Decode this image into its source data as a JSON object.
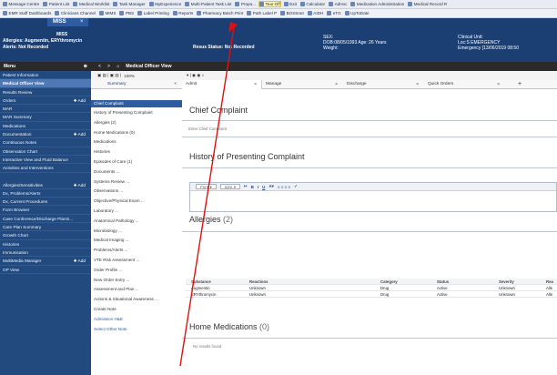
{
  "toolbar1": [
    {
      "label": "Message Centre"
    },
    {
      "label": "Patient List"
    },
    {
      "label": "Medical Worklist"
    },
    {
      "label": "Task Manager"
    },
    {
      "label": "MyExperience"
    },
    {
      "label": "Multi-Patient Task List"
    },
    {
      "label": "Propo..."
    },
    {
      "label": "Tear Off",
      "highlight": true
    },
    {
      "label": "Exit"
    },
    {
      "label": "Calculator"
    },
    {
      "label": "AdHoc"
    },
    {
      "label": "Medication Administration"
    },
    {
      "label": "Medical Record R"
    }
  ],
  "toolbar2": [
    {
      "label": "EMR Staff Dashboards"
    },
    {
      "label": "Clinicians Channel"
    },
    {
      "label": "MIMS"
    },
    {
      "label": "PBS"
    },
    {
      "label": "Label Printing"
    },
    {
      "label": "Reports"
    },
    {
      "label": "Pharmacy Batch Print"
    },
    {
      "label": "Path Label P"
    },
    {
      "label": "BOSSnet"
    },
    {
      "label": "AIDH"
    },
    {
      "label": "eTG"
    },
    {
      "label": "UpToDate"
    }
  ],
  "banner": {
    "app_title": "MISS",
    "close": "×",
    "patient_name": "MISS",
    "allergies": "Allergies: Augmentin, ERYthromycin",
    "alerts": "Alerts: Not Recorded",
    "resus": "Resus Status: Not Recorded",
    "sex": "SEX:",
    "dob": "DOB:08/05/1993  Age: 26 Years",
    "weight": "Weight:",
    "clinical_unit_label": "Clinical Unit:",
    "loc": "Loc:S EMERGENCY",
    "encounter": "Emergency [13/06/2019 08:50"
  },
  "menu": {
    "title": "Menu",
    "pin": "⊕",
    "items": [
      {
        "label": "Patient Information"
      },
      {
        "label": "Medical Officer View",
        "active": true
      },
      {
        "label": "Results Review"
      },
      {
        "label": "Orders",
        "add": "✚ Add"
      },
      {
        "label": "MAR"
      },
      {
        "label": "MAR Summary"
      },
      {
        "label": "Medications"
      },
      {
        "label": "Documentation",
        "add": "✚ Add"
      },
      {
        "label": "Continuous Notes"
      },
      {
        "label": "Observation Chart"
      },
      {
        "label": "Interactive View and Fluid Balance"
      },
      {
        "label": "Activities and Interventions"
      },
      {
        "gap": true
      },
      {
        "label": "Allergies/Sensitivities",
        "add": "✚ Add"
      },
      {
        "label": "Dx, Problems/Alerts"
      },
      {
        "label": "Dx, Current Procedures"
      },
      {
        "label": "Form Browser"
      },
      {
        "label": "Case Conference/Discharge Planni..."
      },
      {
        "label": "Care Plan Summary"
      },
      {
        "label": "Growth Chart"
      },
      {
        "label": "Histories"
      },
      {
        "label": "Immunisation"
      },
      {
        "label": "MultiMedia Manager",
        "add": "✚ Add"
      },
      {
        "label": "OP View"
      }
    ]
  },
  "main": {
    "title": "Medical Officer View",
    "nav_back": "<",
    "nav_fwd": ">",
    "home": "⌂",
    "zoom": "100%",
    "left_panel": {
      "tab": "Summary",
      "tab_close": "×",
      "items": [
        {
          "label": "Chief Complaint",
          "active": true
        },
        {
          "label": "History of Presenting Complaint"
        },
        {
          "label": "Allergies (2)"
        },
        {
          "label": "Home Medications (0)"
        },
        {
          "label": "Medications"
        },
        {
          "label": "Histories"
        },
        {
          "label": "Episodes of Care (1)"
        },
        {
          "label": "Documents ..."
        },
        {
          "label": "Systems Review ..."
        },
        {
          "label": "Observations ..."
        },
        {
          "label": "Objective/Physical Exam ..."
        },
        {
          "label": "Laboratory ..."
        },
        {
          "label": "Anatomical Pathology ..."
        },
        {
          "label": "Microbiology ..."
        },
        {
          "label": "Medical Imaging ..."
        },
        {
          "label": "Problems/Alerts ..."
        },
        {
          "label": "VTE Risk Assessment ..."
        },
        {
          "label": "Order Profile ..."
        },
        {
          "label": "New Order Entry ..."
        },
        {
          "label": "Assessment and Plan ..."
        },
        {
          "label": "Actions & Situational Awareness ..."
        },
        {
          "label": "Create Note"
        },
        {
          "label": "Admission H&E",
          "link": true
        },
        {
          "label": "Select Other Note",
          "link": true
        }
      ]
    },
    "tabs": [
      {
        "label": "Admit",
        "close": "×"
      },
      {
        "label": "Manage",
        "close": "×"
      },
      {
        "label": "Discharge",
        "close": "×"
      },
      {
        "label": "Quick Orders",
        "close": "×"
      },
      {
        "label": "+"
      }
    ],
    "sections": {
      "chief_complaint": {
        "title": "Chief Complaint",
        "placeholder": "Enter Chief Complaint"
      },
      "hpc": {
        "title": "History of Presenting Complaint",
        "font": "Font",
        "size": "Size"
      },
      "allergies": {
        "title": "Allergies",
        "count": "(2)",
        "columns": [
          "Substance",
          "Reactions",
          "Category",
          "Status",
          "Severity",
          "Rea"
        ],
        "rows": [
          [
            "Augmentin",
            "Unknown",
            "Drug",
            "Active",
            "Unknown",
            "Alle"
          ],
          [
            "ERYthromycin",
            "Unknown",
            "Drug",
            "Active",
            "Unknown",
            "Alle"
          ]
        ]
      },
      "home_meds": {
        "title": "Home Medications",
        "count": "(0)",
        "empty": "No results found"
      }
    }
  }
}
